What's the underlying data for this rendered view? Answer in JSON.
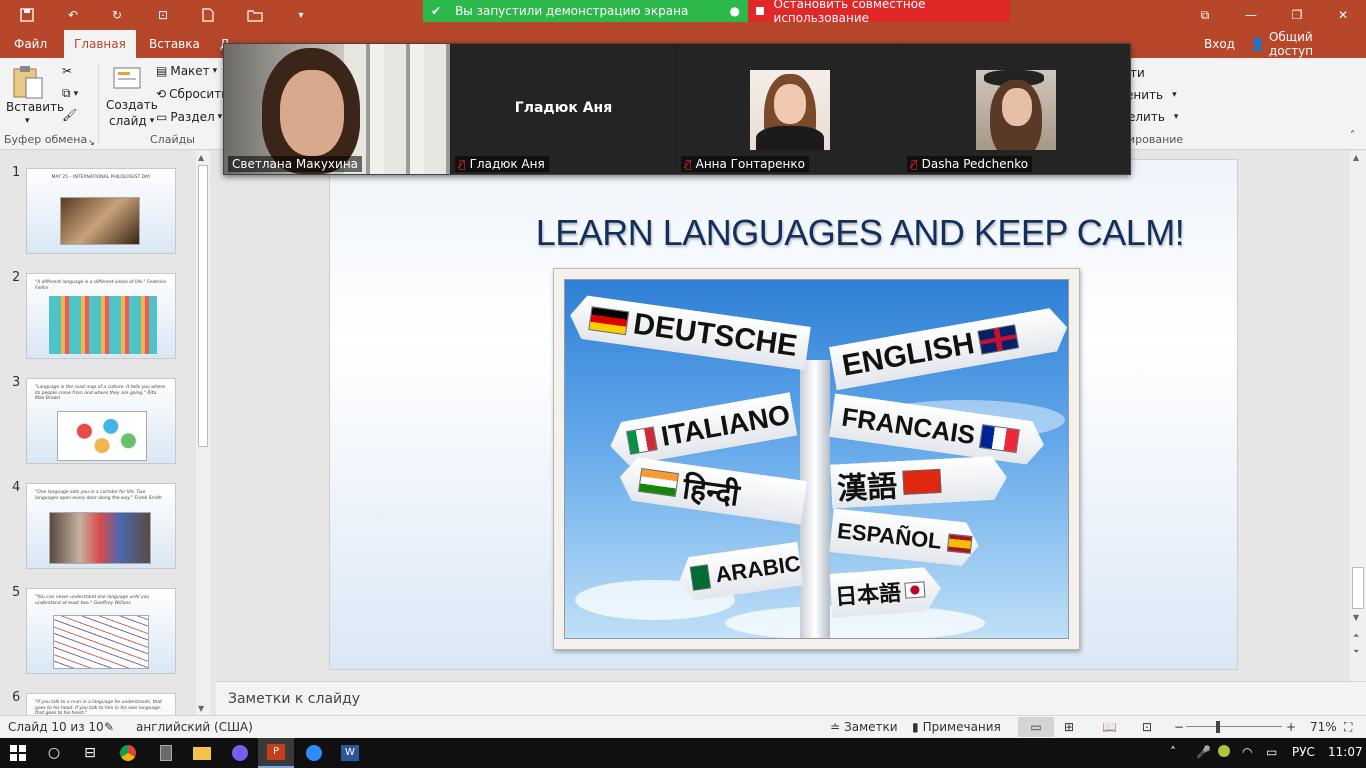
{
  "titlebar": {
    "share_banner_text": "Вы запустили демонстрацию экрана",
    "stop_share_label": "Остановить совместное использование",
    "colors": {
      "brand": "#b7472a",
      "share_green": "#2db84c",
      "share_red": "#e02828"
    }
  },
  "tabs": [
    {
      "label": "Файл"
    },
    {
      "label": "Главная"
    },
    {
      "label": "Вставка"
    },
    {
      "label": "Д"
    }
  ],
  "account": {
    "login_label": "Вход",
    "share_label": "Общий доступ"
  },
  "ribbon": {
    "clipboard": {
      "paste_label": "Вставить",
      "group_label": "Буфер обмена"
    },
    "slides": {
      "new_slide_label_1": "Создать",
      "new_slide_label_2": "слайд",
      "layout_label": "Макет",
      "reset_label": "Сбросить",
      "section_label": "Раздел",
      "group_label": "Слайды"
    },
    "right_partial": {
      "item1": "ти",
      "item2": "енить",
      "item3": "елить",
      "group_label": "ирование"
    }
  },
  "video": {
    "tiles": [
      {
        "name": "Светлана Макухина",
        "muted": false
      },
      {
        "name": "Гладюк Аня",
        "center_name": "Гладюк Аня",
        "muted": true
      },
      {
        "name": "Анна Гонтаренко",
        "muted": true
      },
      {
        "name": "Dasha Pedchenko",
        "muted": true
      }
    ]
  },
  "thumbnails": [
    {
      "num": "1",
      "caption": "MAY 25 – INTERNATIONAL PHILOLOGIST DAY"
    },
    {
      "num": "2",
      "caption": "\"A different language is a different vision of life.\"  Federico Fellini"
    },
    {
      "num": "3",
      "caption": "\"Language is the road map of a culture. It tells you where its people come from and where they are going.\"  Rita Mae Brown"
    },
    {
      "num": "4",
      "caption": "\"One language sets you in a corridor for life. Two languages open every door along the way.\"  Frank Smith"
    },
    {
      "num": "5",
      "caption": "\"You can never understand one language until you understand at least two.\"  Geoffrey Willans"
    },
    {
      "num": "6",
      "caption": "\"If you talk to a man in a language he understands, that goes to his head. If you talk to him in his own language, that goes to his heart.\""
    }
  ],
  "slide": {
    "title": "LEARN LANGUAGES AND KEEP CALM!",
    "signs": [
      "DEUTSCHE",
      "ENGLISH",
      "ITALIANO",
      "FRANCAIS",
      "हिन्दी",
      "漢語",
      "ESPAÑOL",
      "ARABIC",
      "日本語"
    ]
  },
  "notes": {
    "placeholder": "Заметки к слайду"
  },
  "status": {
    "slide_counter": "Слайд 10 из 10",
    "language": "английский (США)",
    "notes_label": "Заметки",
    "comments_label": "Примечания",
    "zoom": "71%"
  },
  "taskbar": {
    "language": "РУС",
    "time": "11:07"
  }
}
